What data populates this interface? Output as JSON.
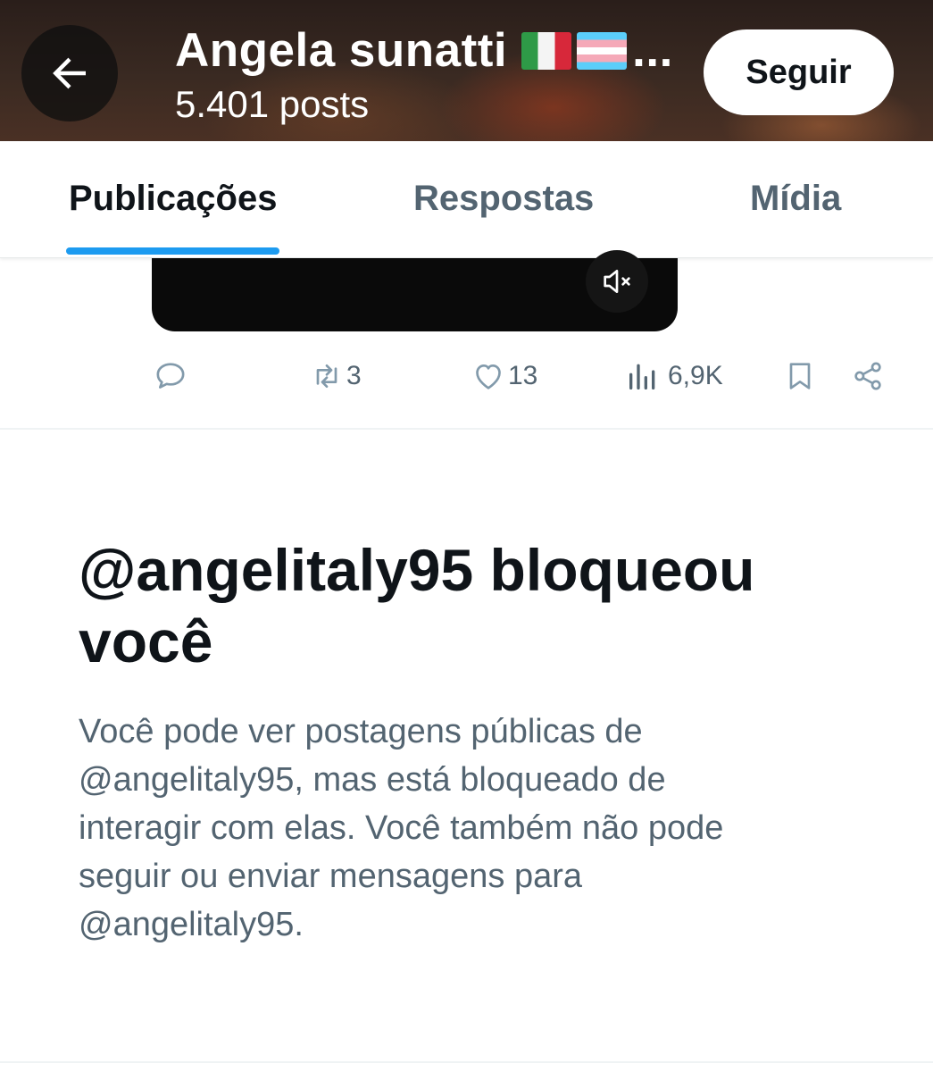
{
  "header": {
    "title": "Angela sunatti",
    "title_flags": [
      "italy-flag-icon",
      "transgender-flag-icon"
    ],
    "title_overflow": "...",
    "posts_count": "5.401 posts",
    "follow_label": "Seguir"
  },
  "tabs": [
    {
      "label": "Publicações",
      "active": true
    },
    {
      "label": "Respostas",
      "active": false
    },
    {
      "label": "Mídia",
      "active": false
    }
  ],
  "post": {
    "actions": {
      "reply_count": "",
      "retweet_count": "3",
      "like_count": "13",
      "views_count": "6,9K"
    },
    "video_muted": true
  },
  "blocked": {
    "title": "@angelitaly95 bloqueou você",
    "description": "Você pode ver postagens públicas de @angelitaly95, mas está bloqueado de interagir com elas. Você também não pode seguir ou enviar mensagens para @angelitaly95."
  },
  "colors": {
    "accent": "#1d9bf0",
    "text_primary": "#0f1419",
    "text_secondary": "#536471"
  }
}
